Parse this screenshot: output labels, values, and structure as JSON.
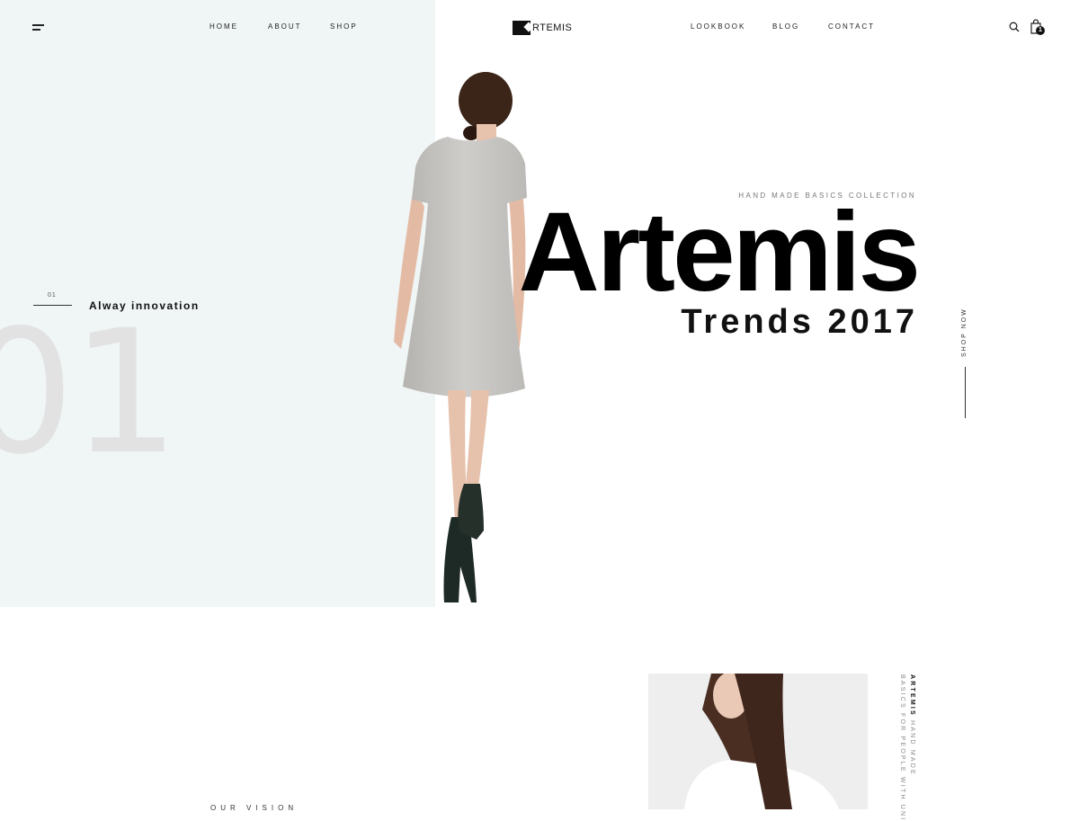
{
  "header": {
    "nav_left": [
      "HOME",
      "ABOUT",
      "SHOP"
    ],
    "nav_right": [
      "LOOKBOOK",
      "BLOG",
      "CONTACT"
    ],
    "logo_text": "RTEMIS",
    "cart_count": "1"
  },
  "hero": {
    "slide_number_small": "01",
    "slide_title": "Alway innovation",
    "slide_number_big": "01",
    "subtitle": "HAND MADE BASICS COLLECTION",
    "headline": "Artemis",
    "subheadline": "Trends 2017",
    "cta": "SHOP NOW"
  },
  "section_vision": {
    "label": "OUR VISION",
    "tagline_brand": "ARTEMIS",
    "tagline_line1": " HAND MADE",
    "tagline_line2": "BASICS FOR PEOPLE WITH UNI"
  },
  "colors": {
    "hero_left_bg": "#f0f5f5",
    "text_dark": "#111111",
    "big_number": "#e2e2e2"
  },
  "icons": [
    "hamburger-menu-icon",
    "search-icon",
    "shopping-bag-icon",
    "logo-mark-icon"
  ]
}
